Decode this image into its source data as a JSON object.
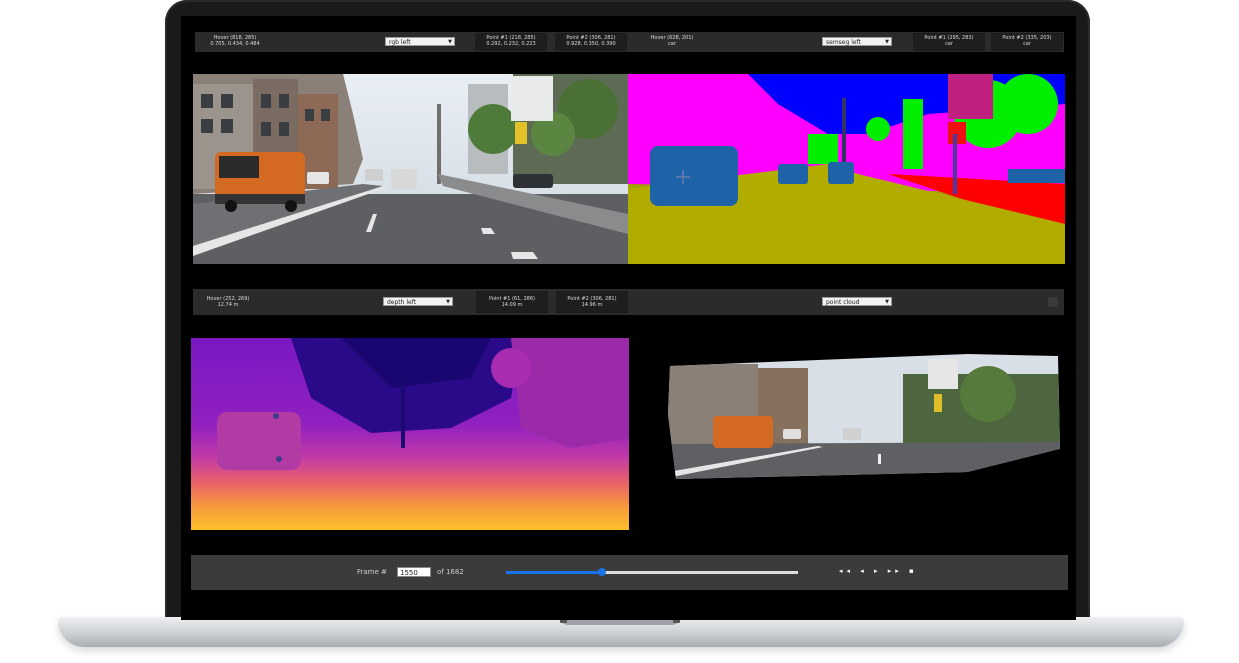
{
  "top_bar": {
    "hover_text": "Hover (818, 285)\n0.705, 0.434, 0.484",
    "left_select": "rgb left",
    "point1_text": "Point #1 (218, 285)\n0.292, 0.232, 0.223",
    "point2_text": "Point #2 (306, 281)\n0.928, 0.350, 0.390",
    "hover_mid_text": "Hover (628, 201)\ncar",
    "right_select": "semseg left",
    "right_point1_text": "Point #1 (295, 283)\ncar",
    "right_point2_text": "Point #2 (335, 203)\ncar"
  },
  "mid_bar": {
    "hover_text": "Hover (252, 269)\n12.74 m",
    "left_select": "depth left",
    "point1_text": "Point #1 (61, 286)\n14.09 m",
    "point2_text": "Point #2 (306, 281)\n14.96 m",
    "right_select": "point cloud"
  },
  "footer": {
    "frame_label": "Frame #",
    "frame_value": "1550",
    "frame_total": "of 1682",
    "progress": 0.33,
    "controls": "◂◂ ◂ ▸ ▸▸ ▪"
  }
}
